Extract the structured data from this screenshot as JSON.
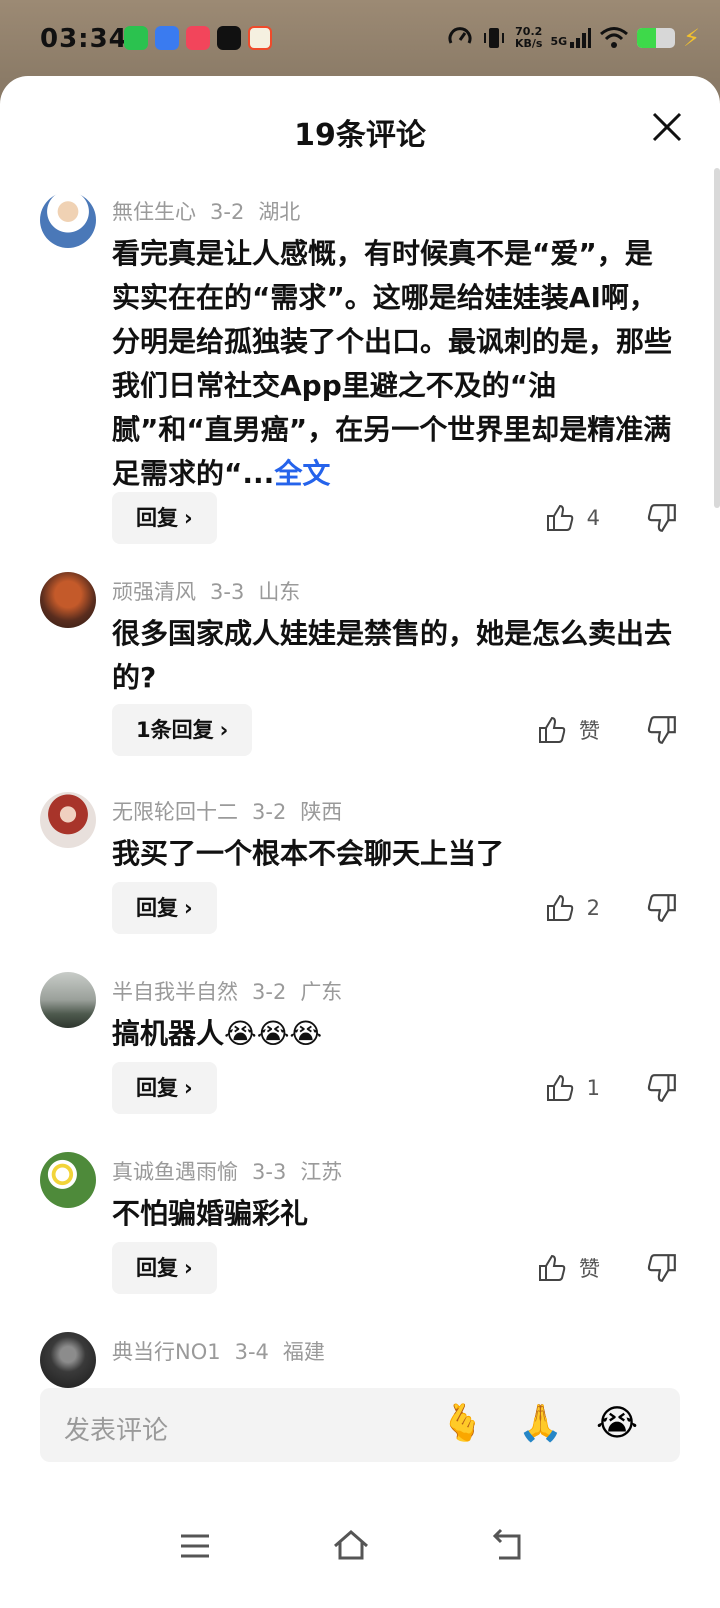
{
  "status": {
    "time": "03:34",
    "speed_value": "70.2",
    "speed_unit": "KB/s",
    "network": "5G",
    "battery_level": 0.5
  },
  "sheet": {
    "title": "19条评论",
    "input_placeholder": "发表评论",
    "emojis": [
      "🫰",
      "🙏",
      "😭"
    ]
  },
  "comments": [
    {
      "user": "無住生心",
      "date": "3-2",
      "region": "湖北",
      "text": "看完真是让人感慨，有时候真不是“爱”，是实实在在的“需求”。这哪是给娃娃装AI啊，分明是给孤独装了个出口。最讽刺的是，那些我们日常社交App里避之不及的“油腻”和“直男癌”，在另一个世界里却是精准满足需求的“...",
      "more": "全文",
      "reply_label": "回复",
      "likes": "4"
    },
    {
      "user": "顽强清风",
      "date": "3-3",
      "region": "山东",
      "text": "很多国家成人娃娃是禁售的，她是怎么卖出去的?",
      "reply_label": "1条回复",
      "likes": "赞"
    },
    {
      "user": "无限轮回十二",
      "date": "3-2",
      "region": "陕西",
      "text": "我买了一个根本不会聊天上当了",
      "reply_label": "回复",
      "likes": "2"
    },
    {
      "user": "半自我半自然",
      "date": "3-2",
      "region": "广东",
      "text": "搞机器人😭😭😭",
      "reply_label": "回复",
      "likes": "1"
    },
    {
      "user": "真诚鱼遇雨愉",
      "date": "3-3",
      "region": "江苏",
      "text": "不怕骗婚骗彩礼",
      "reply_label": "回复",
      "likes": "赞"
    },
    {
      "user": "典当行NO1",
      "date": "3-4",
      "region": "福建"
    }
  ],
  "colors": {
    "link": "#2563eb",
    "meta": "#9a9a9a",
    "button_bg": "#f3f3f3"
  }
}
